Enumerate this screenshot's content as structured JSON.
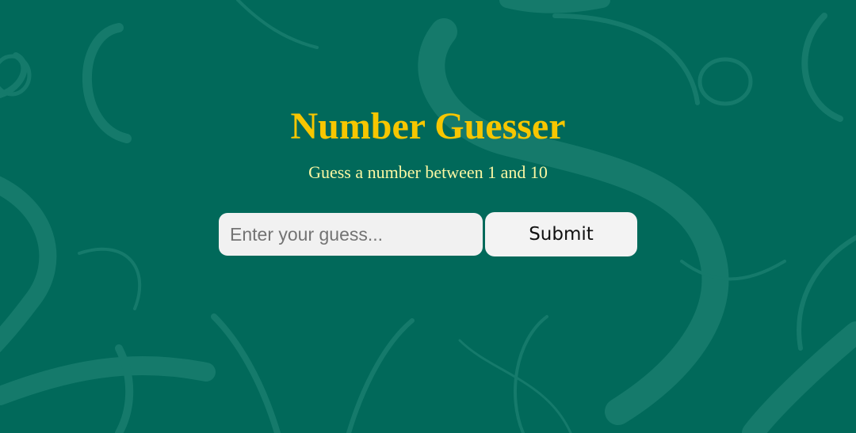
{
  "app": {
    "title": "Number Guesser",
    "subtitle": "Guess a number between 1 and 10"
  },
  "form": {
    "guess_input": {
      "placeholder": "Enter your guess...",
      "value": ""
    },
    "submit_label": "Submit"
  },
  "colors": {
    "background": "#01695a",
    "pattern_stroke": "#157a6b",
    "title": "#f7c600",
    "subtitle": "#fbf7a3",
    "input_background": "#f1f1f1",
    "button_background": "#f3f3f3"
  }
}
